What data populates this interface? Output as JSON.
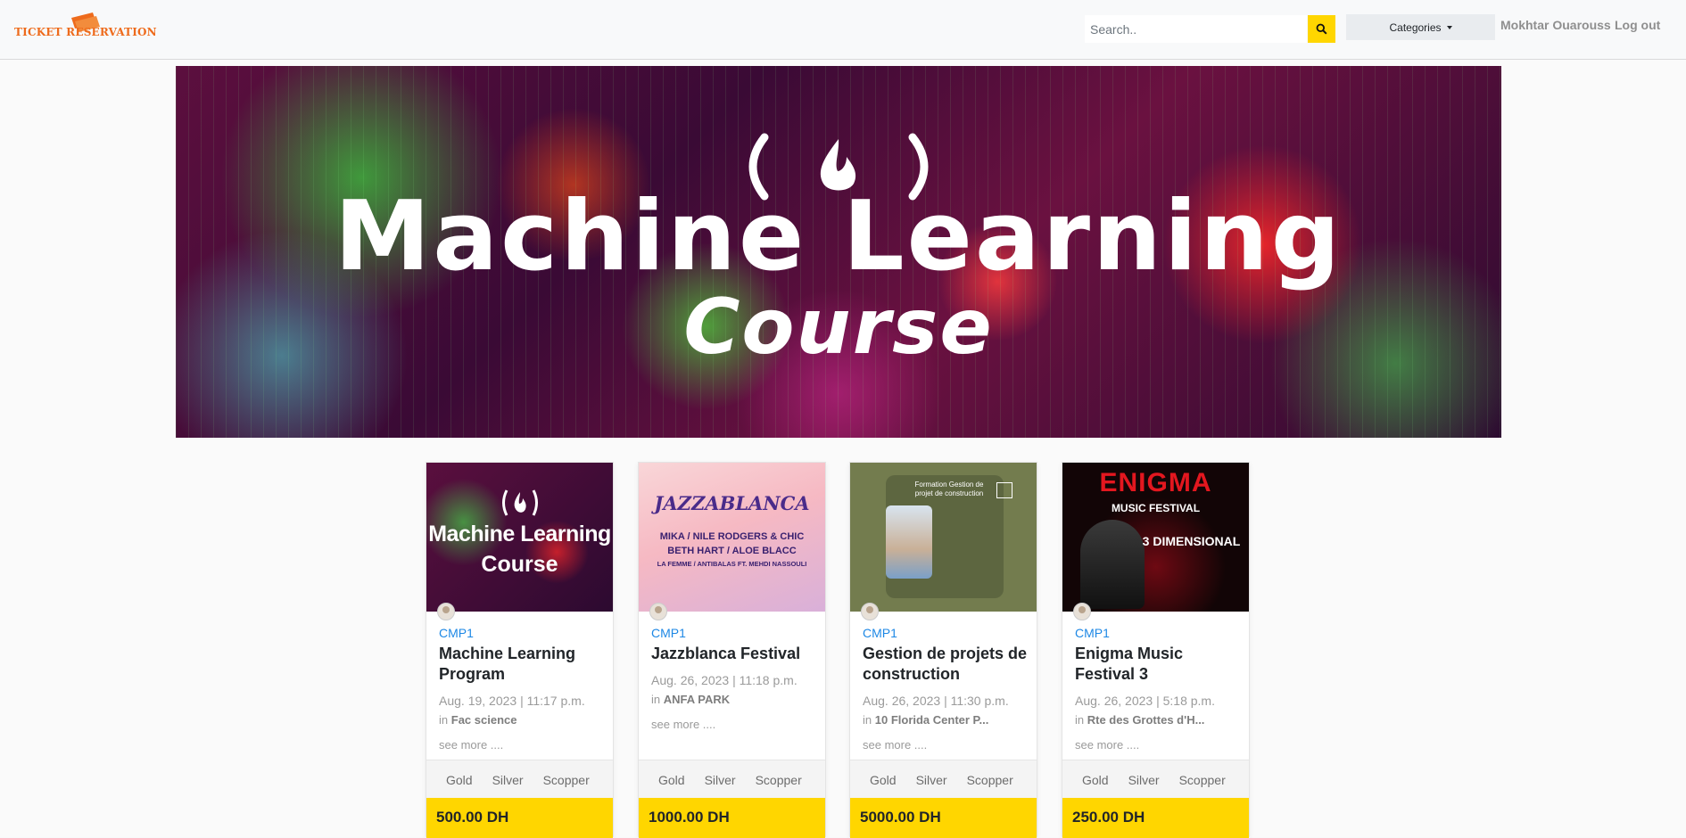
{
  "navbar": {
    "logo_text": "TICKET RESERVATION",
    "search_placeholder": "Search..",
    "categories_label": "Categories",
    "user_name": "Mokhtar Ouarouss",
    "logout_label": "Log out"
  },
  "banner": {
    "title": "Machine Learning",
    "subtitle": "Course"
  },
  "cards": [
    {
      "category": "CMP1",
      "title": "Machine Learning Program",
      "date": "Aug. 19, 2023 | 11:17 p.m.",
      "location_prefix": "in",
      "location": "Fac science",
      "see_more": "see more ....",
      "tiers": [
        "Gold",
        "Silver",
        "Scopper"
      ],
      "price": "500.00 DH",
      "image_text_1": "Machine Learning",
      "image_text_2": "Course"
    },
    {
      "category": "CMP1",
      "title": "Jazzblanca Festival",
      "date": "Aug. 26, 2023 | 11:18 p.m.",
      "location_prefix": "in",
      "location": "ANFA PARK",
      "see_more": "see more ....",
      "tiers": [
        "Gold",
        "Silver",
        "Scopper"
      ],
      "price": "1000.00 DH",
      "image_text_1": "JAZZABLANCA",
      "image_text_2": "MIKA / NILE RODGERS & CHIC",
      "image_text_3": "BETH HART / ALOE BLACC",
      "image_text_4": "LA FEMME / ANTIBALAS FT. MEHDI NASSOULI"
    },
    {
      "category": "CMP1",
      "title": "Gestion de projets de construction",
      "date": "Aug. 26, 2023 | 11:30 p.m.",
      "location_prefix": "in",
      "location": "10 Florida Center P...",
      "see_more": "see more ....",
      "tiers": [
        "Gold",
        "Silver",
        "Scopper"
      ],
      "price": "5000.00 DH",
      "image_text_1": "Formation Gestion de projet de construction"
    },
    {
      "category": "CMP1",
      "title": "Enigma Music Festival 3",
      "date": "Aug. 26, 2023 | 5:18 p.m.",
      "location_prefix": "in",
      "location": "Rte des Grottes d'H...",
      "see_more": "see more ....",
      "tiers": [
        "Gold",
        "Silver",
        "Scopper"
      ],
      "price": "250.00 DH",
      "image_text_1": "ENIGMA",
      "image_text_2": "MUSIC FESTIVAL",
      "image_text_3": "3 DIMENSIONAL"
    }
  ]
}
